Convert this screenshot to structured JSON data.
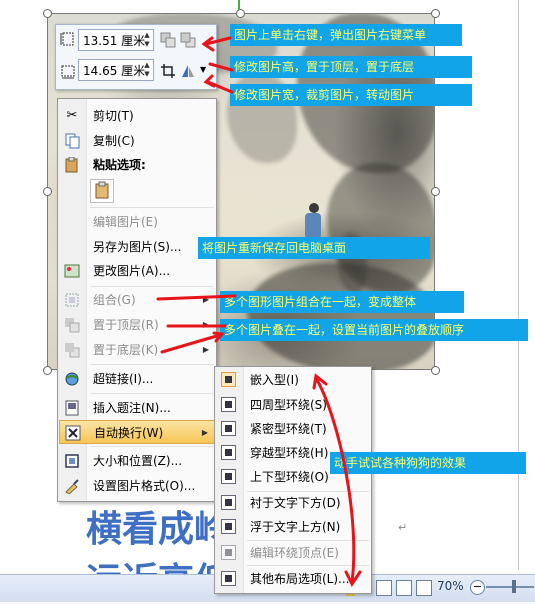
{
  "mini_toolbar": {
    "height_value": "13.51 厘米",
    "width_value": "14.65 厘米"
  },
  "context_menu": {
    "cut": "剪切(T)",
    "copy": "复制(C)",
    "paste_options": "粘贴选项:",
    "edit_picture": "编辑图片(E)",
    "save_as_picture": "另存为图片(S)...",
    "change_picture": "更改图片(A)...",
    "group": "组合(G)",
    "bring_to_front": "置于顶层(R)",
    "send_to_back": "置于底层(K)",
    "hyperlink": "超链接(I)...",
    "insert_caption": "插入题注(N)...",
    "wrap_text": "自动换行(W)",
    "size_position": "大小和位置(Z)...",
    "format_picture": "设置图片格式(O)..."
  },
  "wrap_submenu": {
    "inline": "嵌入型(I)",
    "square": "四周型环绕(S)",
    "tight": "紧密型环绕(T)",
    "through": "穿越型环绕(H)",
    "top_bottom": "上下型环绕(O)",
    "behind_text": "衬于文字下方(D)",
    "in_front_text": "浮于文字上方(N)",
    "edit_wrap_points": "编辑环绕顶点(E)",
    "more_layout": "其他布局选项(L)..."
  },
  "callouts": {
    "c1": "图片上单击右键，弹出图片右键菜单",
    "c2": "修改图片高，置于顶层，置于底层",
    "c3": "修改图片宽，裁剪图片，转动图片",
    "c4": "将图片重新保存回电脑桌面",
    "c5": "多个图形图片组合在一起，变成整体",
    "c6": "多个图片叠在一起，设置当前图片的叠放顺序",
    "c7": "动手试试各种狗狗的效果"
  },
  "document": {
    "line1": "横看成岭",
    "line1_mark": "↵",
    "line2": "远近高低"
  },
  "status_bar": {
    "zoom": "70%"
  },
  "colors": {
    "callout_bg": "#12a4e9",
    "callout_text": "#ffff66",
    "annotation_red": "#e8141b",
    "doc_text": "#3e6fc2"
  }
}
